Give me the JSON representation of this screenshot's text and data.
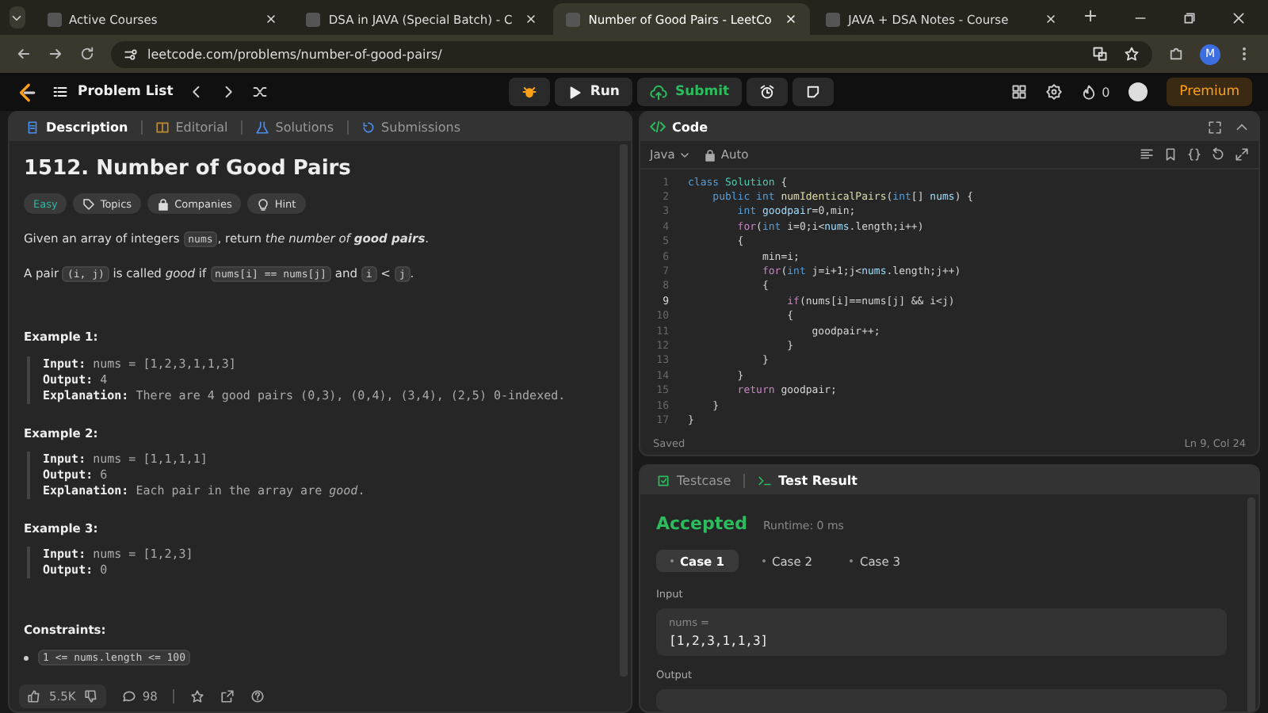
{
  "browser": {
    "tabs": [
      {
        "title": "Active Courses",
        "selected": false
      },
      {
        "title": "DSA in JAVA (Special Batch) - C",
        "selected": false
      },
      {
        "title": "Number of Good Pairs - LeetCo",
        "selected": true
      },
      {
        "title": "JAVA + DSA Notes - Course",
        "selected": false
      }
    ],
    "url": "leetcode.com/problems/number-of-good-pairs/",
    "avatar": "M"
  },
  "navbar": {
    "problem_list": "Problem List",
    "run": "Run",
    "submit": "Submit",
    "streak": "0",
    "premium": "Premium"
  },
  "left_panel": {
    "tabs": [
      {
        "label": "Description",
        "selected": true
      },
      {
        "label": "Editorial",
        "selected": false
      },
      {
        "label": "Solutions",
        "selected": false
      },
      {
        "label": "Submissions",
        "selected": false
      }
    ],
    "title": "1512. Number of Good Pairs",
    "tags": [
      {
        "label": "Easy",
        "kind": "difficulty"
      },
      {
        "label": "Topics",
        "kind": "tag"
      },
      {
        "label": "Companies",
        "kind": "lock"
      },
      {
        "label": "Hint",
        "kind": "bulb"
      }
    ],
    "paragraphs": [
      [
        {
          "text": "Given an array of integers ",
          "kind": "text"
        },
        {
          "text": "nums",
          "kind": "code"
        },
        {
          "text": ", return ",
          "kind": "text"
        },
        {
          "text": "the number of ",
          "kind": "em"
        },
        {
          "text": "good pairs",
          "kind": "strong-em"
        },
        {
          "text": ".",
          "kind": "text"
        }
      ],
      [
        {
          "text": "A pair ",
          "kind": "text"
        },
        {
          "text": "(i, j)",
          "kind": "code"
        },
        {
          "text": " is called ",
          "kind": "text"
        },
        {
          "text": "good",
          "kind": "em"
        },
        {
          "text": " if ",
          "kind": "text"
        },
        {
          "text": "nums[i] == nums[j]",
          "kind": "code"
        },
        {
          "text": " and ",
          "kind": "text"
        },
        {
          "text": "i",
          "kind": "code"
        },
        {
          "text": " < ",
          "kind": "text"
        },
        {
          "text": "j",
          "kind": "code"
        },
        {
          "text": ".",
          "kind": "text"
        }
      ]
    ],
    "examples": [
      {
        "heading": "Example 1:",
        "lines": [
          {
            "label": "Input:",
            "value": "nums = [1,2,3,1,1,3]"
          },
          {
            "label": "Output:",
            "value": "4"
          },
          {
            "label": "Explanation:",
            "value": "There are 4 good pairs (0,3), (0,4), (3,4), (2,5) 0-indexed."
          }
        ]
      },
      {
        "heading": "Example 2:",
        "lines": [
          {
            "label": "Input:",
            "value": "nums = [1,1,1,1]"
          },
          {
            "label": "Output:",
            "value": "6"
          },
          {
            "label": "Explanation:",
            "value": "Each pair in the array are *good*."
          }
        ]
      },
      {
        "heading": "Example 3:",
        "lines": [
          {
            "label": "Input:",
            "value": "nums = [1,2,3]"
          },
          {
            "label": "Output:",
            "value": "0"
          }
        ]
      }
    ],
    "constraints_heading": "Constraints:",
    "constraints": [
      "1 <= nums.length <= 100"
    ],
    "footer": {
      "likes": "5.5K",
      "comments": "98"
    }
  },
  "code_panel": {
    "title": "Code",
    "language": "Java",
    "mode": "Auto",
    "lines": [
      {
        "number": "1",
        "current": false,
        "tokens": [
          {
            "text": "class",
            "kind": "keyword"
          },
          {
            "text": " Solution",
            "kind": "type"
          },
          {
            "text": " {",
            "kind": "plain"
          }
        ]
      },
      {
        "number": "2",
        "current": false,
        "tokens": [
          {
            "text": "    public int",
            "kind": "keyword"
          },
          {
            "text": " numIdenticalPairs",
            "kind": "function"
          },
          {
            "text": "(",
            "kind": "plain"
          },
          {
            "text": "int",
            "kind": "keyword"
          },
          {
            "text": "[] ",
            "kind": "plain"
          },
          {
            "text": "nums",
            "kind": "variable"
          },
          {
            "text": ") {",
            "kind": "plain"
          }
        ]
      },
      {
        "number": "3",
        "current": false,
        "tokens": [
          {
            "text": "        int",
            "kind": "keyword"
          },
          {
            "text": " goodpair",
            "kind": "variable"
          },
          {
            "text": "=0,min;",
            "kind": "plain"
          }
        ]
      },
      {
        "number": "4",
        "current": false,
        "tokens": [
          {
            "text": "        for",
            "kind": "control"
          },
          {
            "text": "(",
            "kind": "plain"
          },
          {
            "text": "int",
            "kind": "keyword"
          },
          {
            "text": " i=0;i<",
            "kind": "plain"
          },
          {
            "text": "nums",
            "kind": "variable"
          },
          {
            "text": ".length;i++)",
            "kind": "plain"
          }
        ]
      },
      {
        "number": "5",
        "current": false,
        "tokens": [
          {
            "text": "        {",
            "kind": "plain"
          }
        ]
      },
      {
        "number": "6",
        "current": false,
        "tokens": [
          {
            "text": "            min=i;",
            "kind": "plain"
          }
        ]
      },
      {
        "number": "7",
        "current": false,
        "tokens": [
          {
            "text": "            for",
            "kind": "control"
          },
          {
            "text": "(",
            "kind": "plain"
          },
          {
            "text": "int",
            "kind": "keyword"
          },
          {
            "text": " j=i+1;j<",
            "kind": "plain"
          },
          {
            "text": "nums",
            "kind": "variable"
          },
          {
            "text": ".length;j++)",
            "kind": "plain"
          }
        ]
      },
      {
        "number": "8",
        "current": false,
        "tokens": [
          {
            "text": "            {",
            "kind": "plain"
          }
        ]
      },
      {
        "number": "9",
        "current": true,
        "tokens": [
          {
            "text": "                if",
            "kind": "control"
          },
          {
            "text": "(nums[i]==nums[j] && i<j)",
            "kind": "plain"
          }
        ]
      },
      {
        "number": "10",
        "current": false,
        "tokens": [
          {
            "text": "                {",
            "kind": "plain"
          }
        ]
      },
      {
        "number": "11",
        "current": false,
        "tokens": [
          {
            "text": "                    goodpair++;",
            "kind": "plain"
          }
        ]
      },
      {
        "number": "12",
        "current": false,
        "tokens": [
          {
            "text": "                }",
            "kind": "plain"
          }
        ]
      },
      {
        "number": "13",
        "current": false,
        "tokens": [
          {
            "text": "            }",
            "kind": "plain"
          }
        ]
      },
      {
        "number": "14",
        "current": false,
        "tokens": [
          {
            "text": "        }",
            "kind": "plain"
          }
        ]
      },
      {
        "number": "15",
        "current": false,
        "tokens": [
          {
            "text": "        return",
            "kind": "control"
          },
          {
            "text": " goodpair;",
            "kind": "plain"
          }
        ]
      },
      {
        "number": "16",
        "current": false,
        "tokens": [
          {
            "text": "    }",
            "kind": "plain"
          }
        ]
      },
      {
        "number": "17",
        "current": false,
        "tokens": [
          {
            "text": "}",
            "kind": "plain"
          }
        ]
      }
    ],
    "status": "Saved",
    "cursor": "Ln 9, Col 24"
  },
  "result_panel": {
    "tabs": [
      {
        "label": "Testcase",
        "selected": false
      },
      {
        "label": "Test Result",
        "selected": true
      }
    ],
    "verdict": "Accepted",
    "runtime": "Runtime: 0 ms",
    "cases": [
      {
        "label": "Case 1",
        "selected": true
      },
      {
        "label": "Case 2",
        "selected": false
      },
      {
        "label": "Case 3",
        "selected": false
      }
    ],
    "input_label": "Input",
    "input_name": "nums =",
    "input_value": "[1,2,3,1,1,3]",
    "output_label": "Output"
  }
}
